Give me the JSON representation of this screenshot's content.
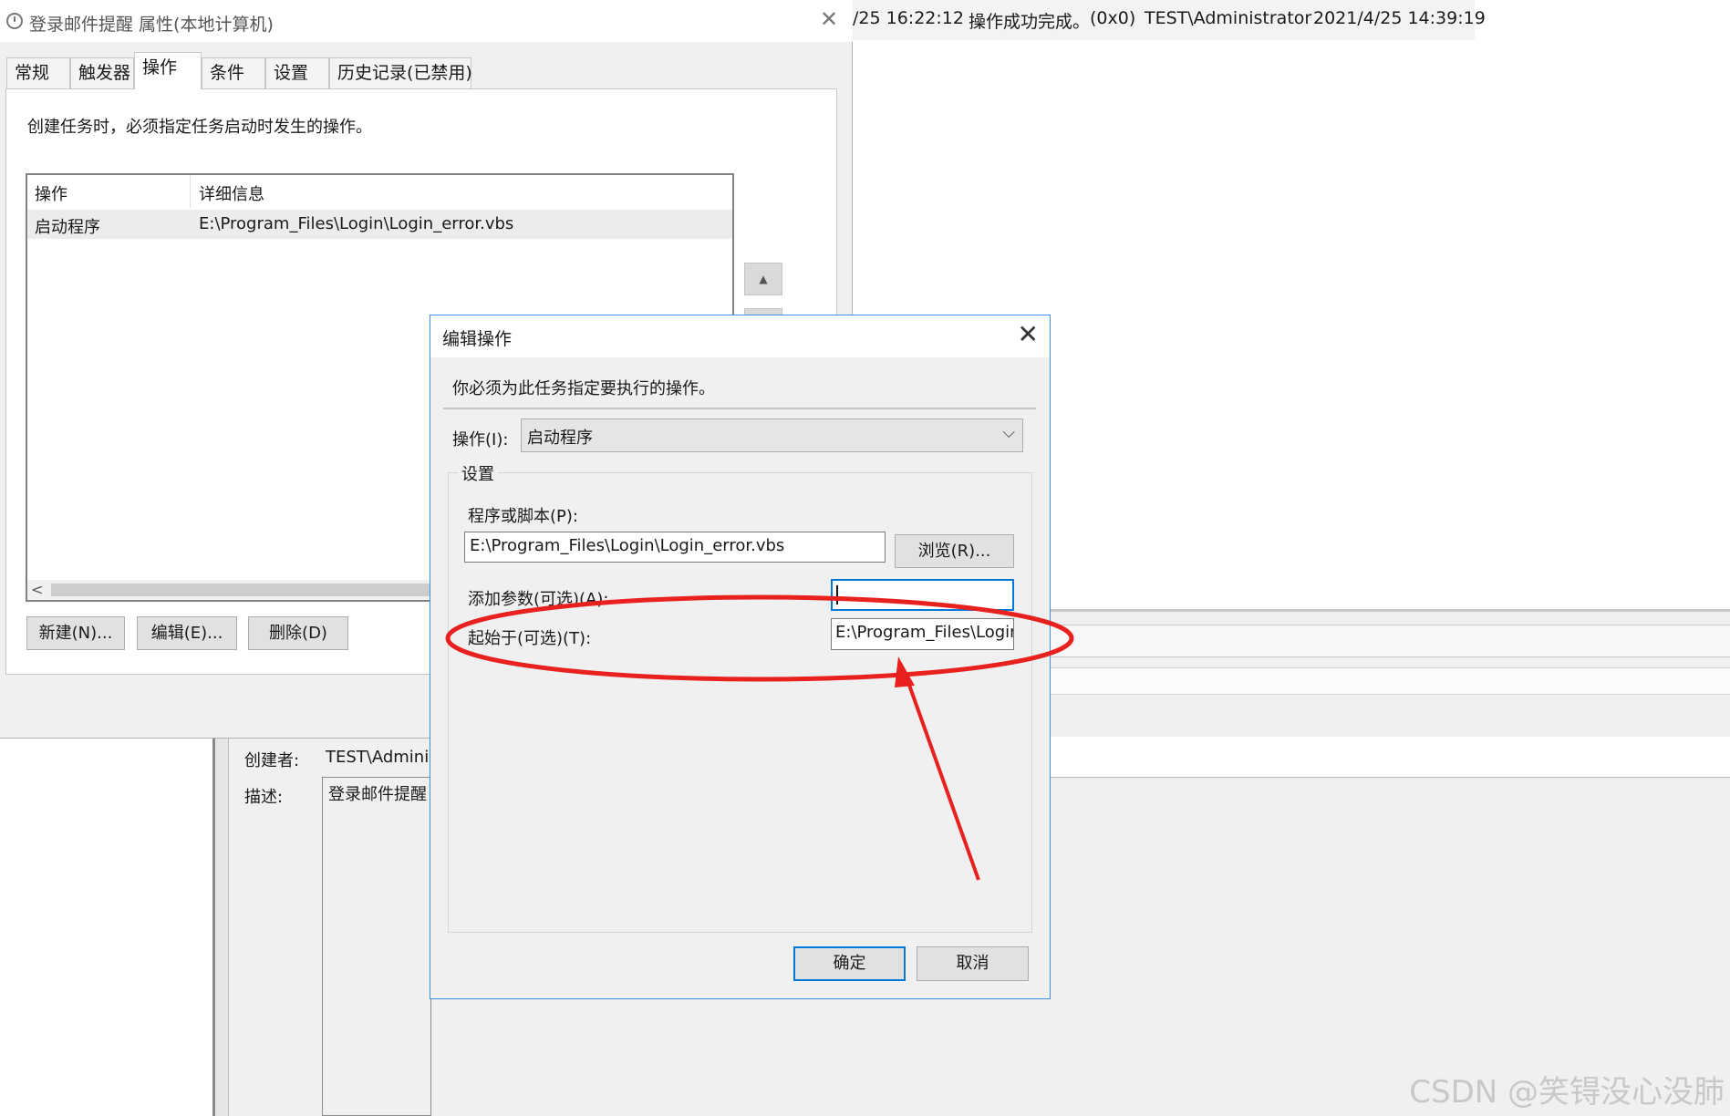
{
  "background_window": {
    "log_row": {
      "time_fragment": "/25 16:22:12",
      "result": "操作成功完成。",
      "code": "(0x0)",
      "user": "TEST\\Administrator",
      "datetime": "2021/4/25 14:39:19"
    },
    "creator_label": "创建者:",
    "creator_value": "TEST\\Adminis",
    "description_label": "描述:",
    "description_value": "登录邮件提醒"
  },
  "properties_window": {
    "title": "登录邮件提醒 属性(本地计算机)",
    "tabs": [
      {
        "label": "常规"
      },
      {
        "label": "触发器"
      },
      {
        "label": "操作",
        "active": true
      },
      {
        "label": "条件"
      },
      {
        "label": "设置"
      },
      {
        "label": "历史记录(已禁用)"
      }
    ],
    "instruction": "创建任务时，必须指定任务启动时发生的操作。",
    "list": {
      "columns": [
        "操作",
        "详细信息"
      ],
      "rows": [
        {
          "action": "启动程序",
          "details": "E:\\Program_Files\\Login\\Login_error.vbs"
        }
      ]
    },
    "buttons": {
      "new": "新建(N)...",
      "edit": "编辑(E)...",
      "delete": "删除(D)"
    }
  },
  "edit_dialog": {
    "title": "编辑操作",
    "instruction": "你必须为此任务指定要执行的操作。",
    "action_label": "操作(I):",
    "action_value": "启动程序",
    "settings_legend": "设置",
    "program_label": "程序或脚本(P):",
    "program_value": "E:\\Program_Files\\Login\\Login_error.vbs",
    "browse_label": "浏览(R)...",
    "args_label": "添加参数(可选)(A):",
    "args_value": "",
    "startin_label": "起始于(可选)(T):",
    "startin_value": "E:\\Program_Files\\Login",
    "ok_label": "确定",
    "cancel_label": "取消"
  },
  "annotation": {
    "color": "#e8211f"
  },
  "watermark": "CSDN @笑锝没心没肺"
}
